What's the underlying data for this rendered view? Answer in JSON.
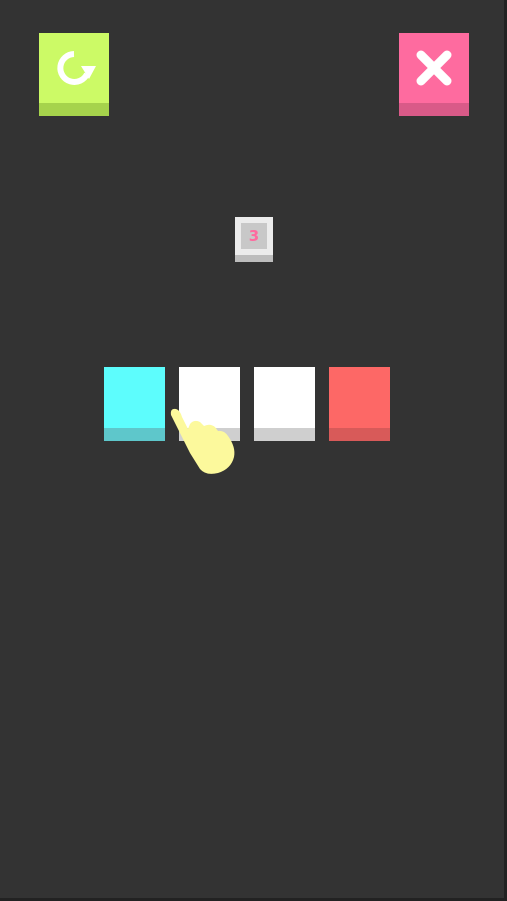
{
  "colors": {
    "background": "#333333",
    "restart_face": "#ccfa66",
    "restart_base": "#a6d34c",
    "close_face": "#fe6b9f",
    "close_base": "#d95a88",
    "counter_outer": "#ececec",
    "counter_inner": "#c8c8c8",
    "counter_base": "#bdbdbd",
    "counter_digit": "#fe6b9f",
    "hand": "#fcf99c"
  },
  "icons": {
    "restart": "restart-icon",
    "close": "close-icon",
    "hand": "pointing-hand-icon"
  },
  "counter": {
    "value": "3"
  },
  "tiles": [
    {
      "color": "#5dfdfd",
      "base": "#5ec7cb"
    },
    {
      "color": "#ffffff",
      "base": "#cfcfcf"
    },
    {
      "color": "#ffffff",
      "base": "#cfcfcf"
    },
    {
      "color": "#fd6866",
      "base": "#d85a59"
    }
  ]
}
